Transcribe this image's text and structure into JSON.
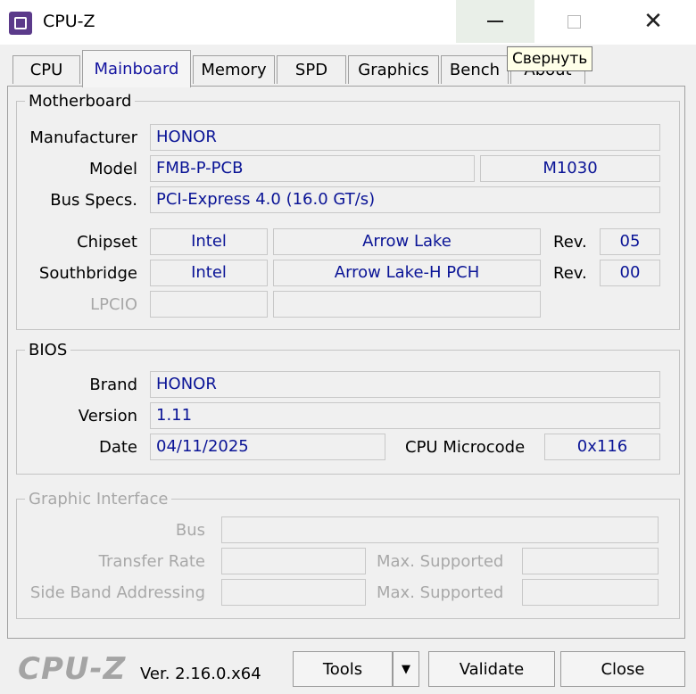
{
  "window": {
    "title": "CPU-Z",
    "tooltip": "Свернуть"
  },
  "tabs": [
    "CPU",
    "Mainboard",
    "Memory",
    "SPD",
    "Graphics",
    "Bench",
    "About"
  ],
  "motherboard": {
    "legend": "Motherboard",
    "manufacturer_label": "Manufacturer",
    "manufacturer": "HONOR",
    "model_label": "Model",
    "model": "FMB-P-PCB",
    "model_rev": "M1030",
    "bus_label": "Bus Specs.",
    "bus": "PCI-Express 4.0 (16.0 GT/s)",
    "chipset_label": "Chipset",
    "chipset_vendor": "Intel",
    "chipset_name": "Arrow Lake",
    "chipset_rev_label": "Rev.",
    "chipset_rev": "05",
    "southbridge_label": "Southbridge",
    "southbridge_vendor": "Intel",
    "southbridge_name": "Arrow Lake-H PCH",
    "southbridge_rev_label": "Rev.",
    "southbridge_rev": "00",
    "lpcio_label": "LPCIO"
  },
  "bios": {
    "legend": "BIOS",
    "brand_label": "Brand",
    "brand": "HONOR",
    "version_label": "Version",
    "version": "1.11",
    "date_label": "Date",
    "date": "04/11/2025",
    "microcode_label": "CPU Microcode",
    "microcode": "0x116"
  },
  "graphic_interface": {
    "legend": "Graphic Interface",
    "bus_label": "Bus",
    "transfer_label": "Transfer Rate",
    "sideband_label": "Side Band Addressing",
    "max_supported_label": "Max. Supported"
  },
  "footer": {
    "logo": "CPU-Z",
    "version": "Ver. 2.16.0.x64",
    "tools_label": "Tools",
    "validate_label": "Validate",
    "close_label": "Close"
  }
}
